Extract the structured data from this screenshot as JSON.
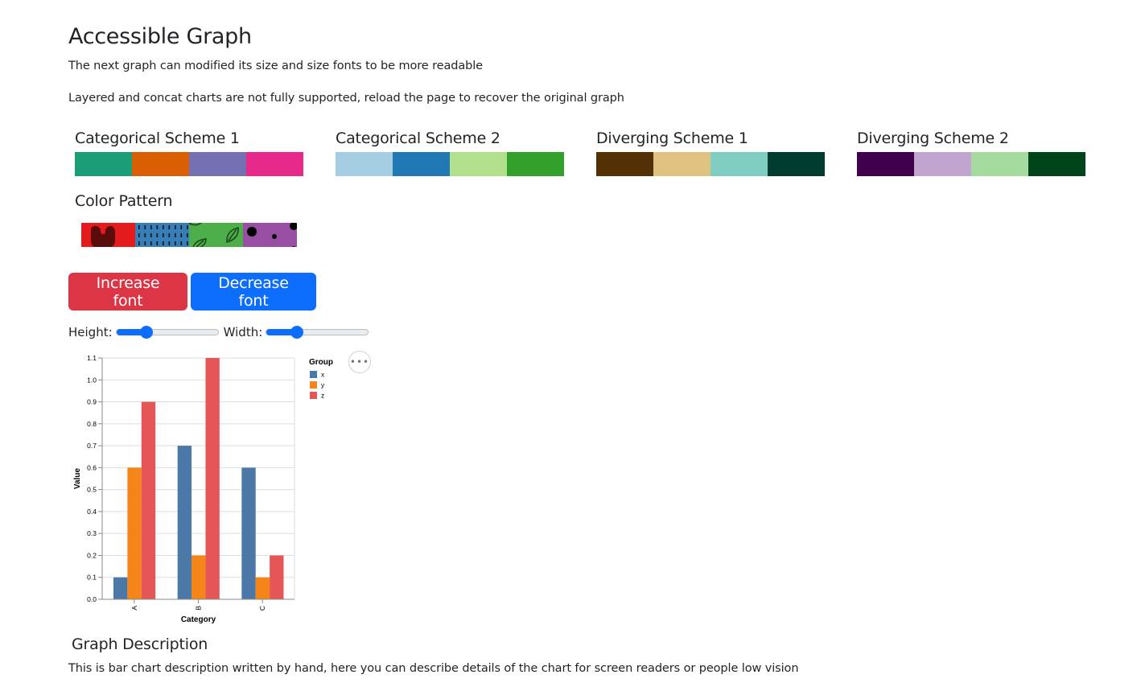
{
  "page": {
    "title": "Accessible Graph",
    "intro_1": "The next graph can modified its size and size fonts to be more readable",
    "intro_2": "Layered and concat charts are not fully supported, reload the page to recover the original graph"
  },
  "schemes": [
    {
      "title": "Categorical Scheme 1",
      "colors": [
        "#1b9e77",
        "#d95f02",
        "#7570b3",
        "#e7298a"
      ]
    },
    {
      "title": "Categorical Scheme 2",
      "colors": [
        "#a6cee3",
        "#1f78b4",
        "#b2df8a",
        "#33a02c"
      ]
    },
    {
      "title": "Diverging Scheme 1",
      "colors": [
        "#543005",
        "#dfc27d",
        "#80cdc1",
        "#003c30"
      ]
    },
    {
      "title": "Diverging Scheme 2",
      "colors": [
        "#40004b",
        "#c2a5cf",
        "#a6dba0",
        "#00441b"
      ]
    }
  ],
  "color_pattern": {
    "title": "Color Pattern",
    "patterns": [
      {
        "name": "blob",
        "color": "#e41a1c"
      },
      {
        "name": "dashes",
        "color": "#377eb8"
      },
      {
        "name": "leaves",
        "color": "#4daf4a"
      },
      {
        "name": "dots",
        "color": "#984ea3"
      }
    ]
  },
  "controls": {
    "increase_label": "Increase font",
    "decrease_label": "Decrease font",
    "height_label": "Height:",
    "width_label": "Width:",
    "height_value_fraction": 0.3,
    "width_value_fraction": 0.3
  },
  "chart_actions_label": "•••",
  "description": {
    "title": "Graph Description",
    "text": "This is bar chart description written by hand, here you can describe details of the chart for screen readers or people low vision"
  },
  "chart_data": {
    "type": "bar",
    "mode": "grouped",
    "title": "",
    "xlabel": "Category",
    "ylabel": "Value",
    "categories": [
      "A",
      "B",
      "C"
    ],
    "series": [
      {
        "name": "x",
        "color": "#4c78a8",
        "values": [
          0.1,
          0.7,
          0.6
        ]
      },
      {
        "name": "y",
        "color": "#f58518",
        "values": [
          0.6,
          0.2,
          0.1
        ]
      },
      {
        "name": "z",
        "color": "#e45756",
        "values": [
          0.9,
          1.1,
          0.2
        ]
      }
    ],
    "ylim": [
      0,
      1.1
    ],
    "yticks": [
      "0.0",
      "0.1",
      "0.2",
      "0.3",
      "0.4",
      "0.5",
      "0.6",
      "0.7",
      "0.8",
      "0.9",
      "1.0",
      "1.1"
    ],
    "grid": true,
    "legend": {
      "title": "Group",
      "position": "right"
    }
  }
}
